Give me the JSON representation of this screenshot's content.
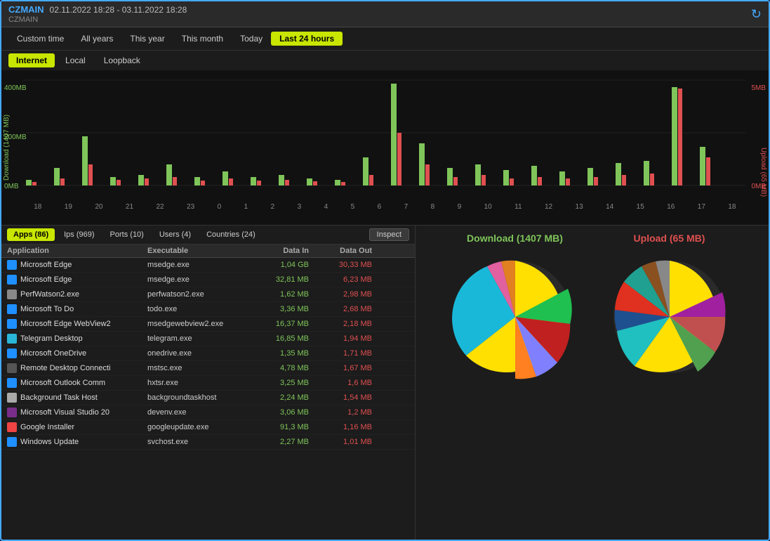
{
  "window": {
    "hostname": "CZMAIN",
    "date_range": "02.11.2022 18:28 - 03.11.2022 18:28",
    "subtitle": "CZMAIN"
  },
  "time_tabs": [
    {
      "id": "custom",
      "label": "Custom time",
      "active": false
    },
    {
      "id": "allyears",
      "label": "All years",
      "active": false
    },
    {
      "id": "year",
      "label": "This year",
      "active": false
    },
    {
      "id": "month",
      "label": "This month",
      "active": false
    },
    {
      "id": "today",
      "label": "Today",
      "active": false
    },
    {
      "id": "last24",
      "label": "Last 24 hours",
      "active": true
    }
  ],
  "network_tabs": [
    {
      "label": "Internet",
      "active": true
    },
    {
      "label": "Local",
      "active": false
    },
    {
      "label": "Loopback",
      "active": false
    }
  ],
  "chart": {
    "y_left_label": "Download (1407 MB)",
    "y_right_label": "Upload (65 MB)",
    "y_max_label": "400MB",
    "y_mid_label": "200MB",
    "y_min_label": "0MB",
    "y_right_max": "5MB",
    "y_right_min": "0MB",
    "x_labels": [
      "18",
      "19",
      "20",
      "21",
      "22",
      "23",
      "0",
      "1",
      "2",
      "3",
      "4",
      "5",
      "6",
      "7",
      "8",
      "9",
      "10",
      "11",
      "12",
      "13",
      "14",
      "15",
      "16",
      "17",
      "18"
    ]
  },
  "app_tabs": [
    {
      "label": "Apps (86)",
      "active": true
    },
    {
      "label": "Ips (969)",
      "active": false
    },
    {
      "label": "Ports (10)",
      "active": false
    },
    {
      "label": "Users (4)",
      "active": false
    },
    {
      "label": "Countries (24)",
      "active": false
    }
  ],
  "inspect_label": "Inspect",
  "table": {
    "headers": [
      "Application",
      "Executable",
      "Data In",
      "Data Out"
    ],
    "rows": [
      {
        "app": "Microsoft Edge",
        "exe": "msedge.exe",
        "in": "1,04 GB",
        "out": "30,33 MB",
        "color": "#1e90ff"
      },
      {
        "app": "Microsoft Edge",
        "exe": "msedge.exe",
        "in": "32,81 MB",
        "out": "6,23 MB",
        "color": "#1e90ff"
      },
      {
        "app": "PerfWatson2.exe",
        "exe": "perfwatson2.exe",
        "in": "1,62 MB",
        "out": "2,98 MB",
        "color": "#888"
      },
      {
        "app": "Microsoft To Do",
        "exe": "todo.exe",
        "in": "3,36 MB",
        "out": "2,68 MB",
        "color": "#1e90ff"
      },
      {
        "app": "Microsoft Edge WebView2",
        "exe": "msedgewebview2.exe",
        "in": "16,37 MB",
        "out": "2,18 MB",
        "color": "#1e90ff"
      },
      {
        "app": "Telegram Desktop",
        "exe": "telegram.exe",
        "in": "16,85 MB",
        "out": "1,94 MB",
        "color": "#29b6d8"
      },
      {
        "app": "Microsoft OneDrive",
        "exe": "onedrive.exe",
        "in": "1,35 MB",
        "out": "1,71 MB",
        "color": "#1e90ff"
      },
      {
        "app": "Remote Desktop Connecti",
        "exe": "mstsc.exe",
        "in": "4,78 MB",
        "out": "1,67 MB",
        "color": "#555"
      },
      {
        "app": "Microsoft Outlook Comm",
        "exe": "hxtsr.exe",
        "in": "3,25 MB",
        "out": "1,6 MB",
        "color": "#1e90ff"
      },
      {
        "app": "Background Task Host",
        "exe": "backgroundtaskhost",
        "in": "2,24 MB",
        "out": "1,54 MB",
        "color": "#aaa"
      },
      {
        "app": "Microsoft Visual Studio 20",
        "exe": "devenv.exe",
        "in": "3,06 MB",
        "out": "1,2 MB",
        "color": "#7b2d8b"
      },
      {
        "app": "Google Installer",
        "exe": "googleupdate.exe",
        "in": "91,3 MB",
        "out": "1,16 MB",
        "color": "#e44"
      },
      {
        "app": "Windows Update",
        "exe": "svchost.exe",
        "in": "2,27 MB",
        "out": "1,01 MB",
        "color": "#1e90ff"
      }
    ]
  },
  "download_label": "Download (1407 MB)",
  "upload_label": "Upload (65 MB)"
}
